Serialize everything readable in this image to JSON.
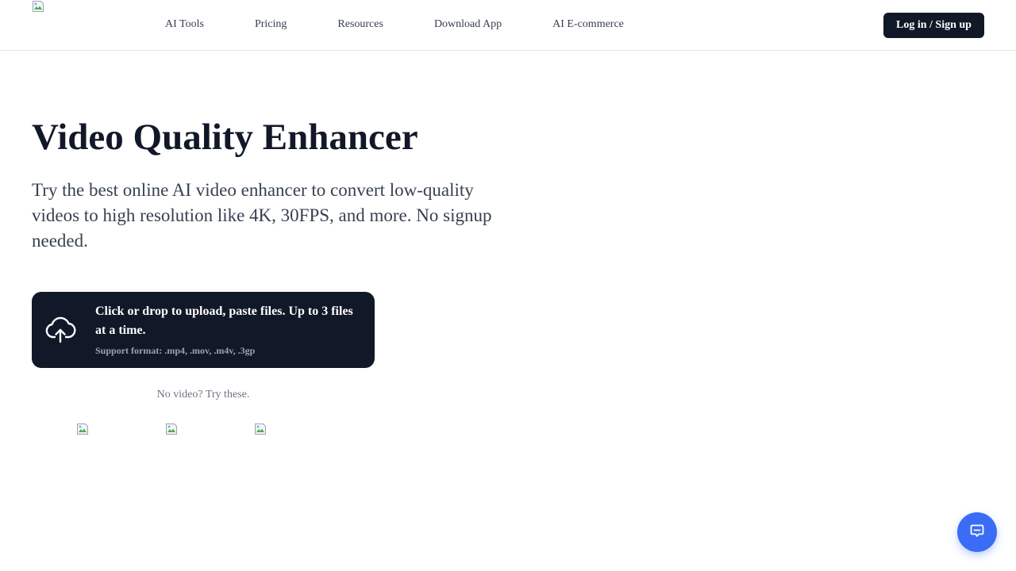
{
  "header": {
    "logo_icon": "broken-image-icon",
    "nav": [
      {
        "label": "AI Tools"
      },
      {
        "label": "Pricing"
      },
      {
        "label": "Resources"
      },
      {
        "label": "Download App"
      },
      {
        "label": "AI E-commerce"
      }
    ],
    "login_label": "Log in / Sign up"
  },
  "hero": {
    "title": "Video Quality Enhancer",
    "subtitle": "Try the best online AI video enhancer to convert low-quality videos to high resolution like 4K, 30FPS, and more. No signup needed."
  },
  "upload": {
    "icon": "cloud-upload-icon",
    "main_text": "Click or drop to upload, paste files. Up to 3 files at a time.",
    "formats_text": "Support format: .mp4, .mov, .m4v, .3gp"
  },
  "samples": {
    "prompt": "No video? Try these.",
    "items": [
      {
        "icon": "broken-image-icon"
      },
      {
        "icon": "broken-image-icon"
      },
      {
        "icon": "broken-image-icon"
      }
    ]
  },
  "chat": {
    "icon": "chat-bubble-icon"
  },
  "colors": {
    "primary_dark": "#111827",
    "accent_blue": "#3b6cf6",
    "text_muted": "#6b7280"
  }
}
